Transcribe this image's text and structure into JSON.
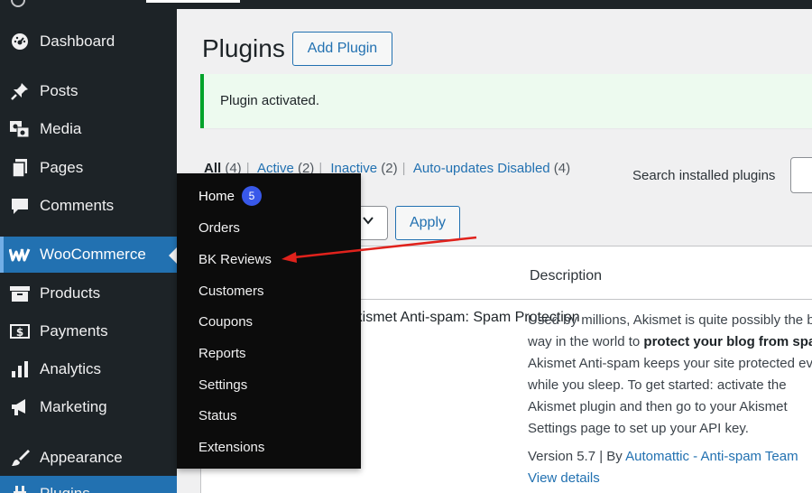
{
  "sidebar": {
    "items": [
      {
        "label": "Dashboard"
      },
      {
        "label": "Posts"
      },
      {
        "label": "Media"
      },
      {
        "label": "Pages"
      },
      {
        "label": "Comments"
      },
      {
        "label": "WooCommerce"
      },
      {
        "label": "Products"
      },
      {
        "label": "Payments"
      },
      {
        "label": "Analytics"
      },
      {
        "label": "Marketing"
      },
      {
        "label": "Appearance"
      },
      {
        "label": "Plugins"
      }
    ]
  },
  "flyout": {
    "items": [
      {
        "label": "Home",
        "badge": "5"
      },
      {
        "label": "Orders"
      },
      {
        "label": "BK Reviews"
      },
      {
        "label": "Customers"
      },
      {
        "label": "Coupons"
      },
      {
        "label": "Reports"
      },
      {
        "label": "Settings"
      },
      {
        "label": "Status"
      },
      {
        "label": "Extensions"
      }
    ]
  },
  "header": {
    "title": "Plugins",
    "add_button": "Add Plugin"
  },
  "notice": {
    "text": "Plugin activated."
  },
  "filters": {
    "all": {
      "label": "All",
      "count": "(4)"
    },
    "active": {
      "label": "Active",
      "count": "(2)"
    },
    "inactive": {
      "label": "Inactive",
      "count": "(2)"
    },
    "auto": {
      "label": "Auto-updates Disabled",
      "count": "(4)"
    },
    "sep": "|"
  },
  "search": {
    "label": "Search installed plugins"
  },
  "bulk": {
    "apply_label": "Apply"
  },
  "table": {
    "description_header": "Description",
    "row": {
      "name": "Akismet Anti-spam: Spam Protection",
      "desc_1": "Used by millions, Akismet is quite possibly the",
      "desc_2": "best way in the world to ",
      "desc_bold": "protect your blog from spam",
      "desc_3": ". Akismet Anti-spam keeps your site protected even while you sleep. To get started: activate the Akismet plugin and then go to your Akismet Settings page to set up your API key.",
      "version_prefix": "Version 5.7 | By ",
      "author": "Automattic - Anti-spam Team",
      "details": "View details"
    }
  },
  "colors": {
    "sidebar_bg": "#1d2327",
    "accent": "#2271b1",
    "notice_border": "#00a32a",
    "annotation_arrow": "#e0221c"
  }
}
